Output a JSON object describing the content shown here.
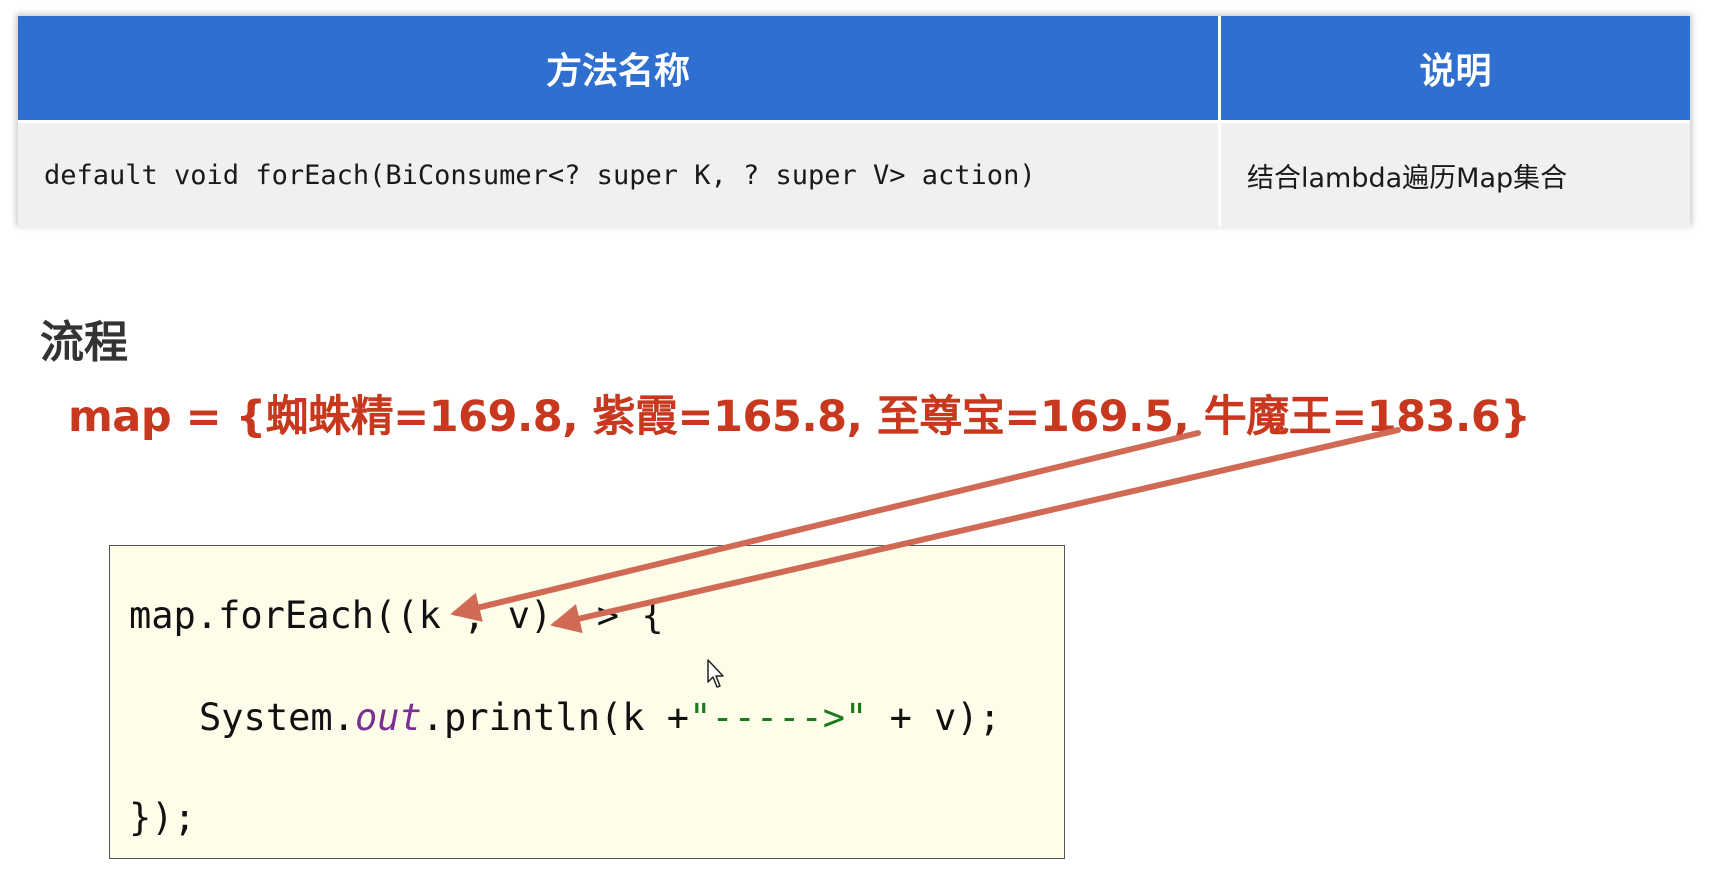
{
  "table": {
    "headers": {
      "name": "方法名称",
      "desc": "说明"
    },
    "rows": [
      {
        "signature": "default void forEach(BiConsumer<? super K, ? super V> action)",
        "description": "结合lambda遍历Map集合"
      }
    ]
  },
  "section": {
    "title": "流程"
  },
  "map_text": "map = {蜘蛛精=169.8, 紫霞=165.8, 至尊宝=169.5, 牛魔王=183.6}",
  "code": {
    "line1": "map.forEach((k , v) -> {",
    "line2_prefix": "System.",
    "line2_field": "out",
    "line2_mid": ".println(k +",
    "line2_string": "\"----->\"",
    "line2_suffix": " + v);",
    "line3": "});"
  },
  "colors": {
    "header_bg": "#2e6fd0",
    "map_text": "#c8381e",
    "arrow": "#d06a55",
    "code_bg": "#fefde9",
    "italic_field": "#7a2f92",
    "string": "#1b7a1b"
  },
  "icons": {
    "cursor": "mouse-pointer-icon"
  }
}
